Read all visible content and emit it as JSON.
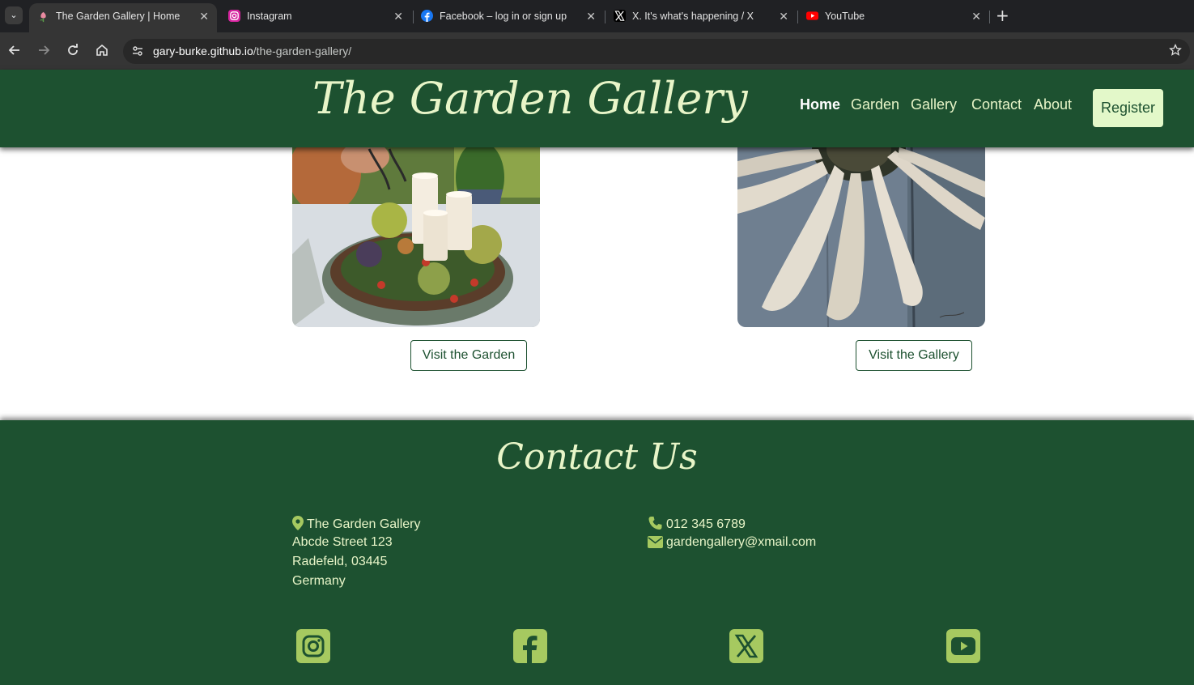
{
  "browser": {
    "tabs": [
      {
        "title": "The Garden Gallery | Home",
        "active": true
      },
      {
        "title": "Instagram",
        "active": false
      },
      {
        "title": "Facebook – log in or sign up",
        "active": false
      },
      {
        "title": "X. It's what's happening / X",
        "active": false
      },
      {
        "title": "YouTube",
        "active": false
      }
    ],
    "url_host": "gary-burke.github.io",
    "url_path": "/the-garden-gallery/"
  },
  "header": {
    "logo": "The Garden Gallery",
    "nav": [
      {
        "label": "Home",
        "active": true
      },
      {
        "label": "Garden",
        "active": false
      },
      {
        "label": "Gallery",
        "active": false
      },
      {
        "label": "Contact",
        "active": false
      },
      {
        "label": "About",
        "active": false
      }
    ],
    "register_label": "Register"
  },
  "main": {
    "garden_button": "Visit the Garden",
    "gallery_button": "Visit the Gallery"
  },
  "footer": {
    "title": "Contact Us",
    "address": [
      "The Garden Gallery",
      "Abcde Street 123",
      "Radefeld, 03445",
      "Germany"
    ],
    "phone": "012 345 6789",
    "email": "gardengallery@xmail.com",
    "social": [
      "instagram-icon",
      "facebook-icon",
      "x-icon",
      "youtube-icon"
    ]
  },
  "colors": {
    "brand_green": "#1d5130",
    "cream": "#e8f5c8",
    "icon_green": "#a6c960"
  }
}
